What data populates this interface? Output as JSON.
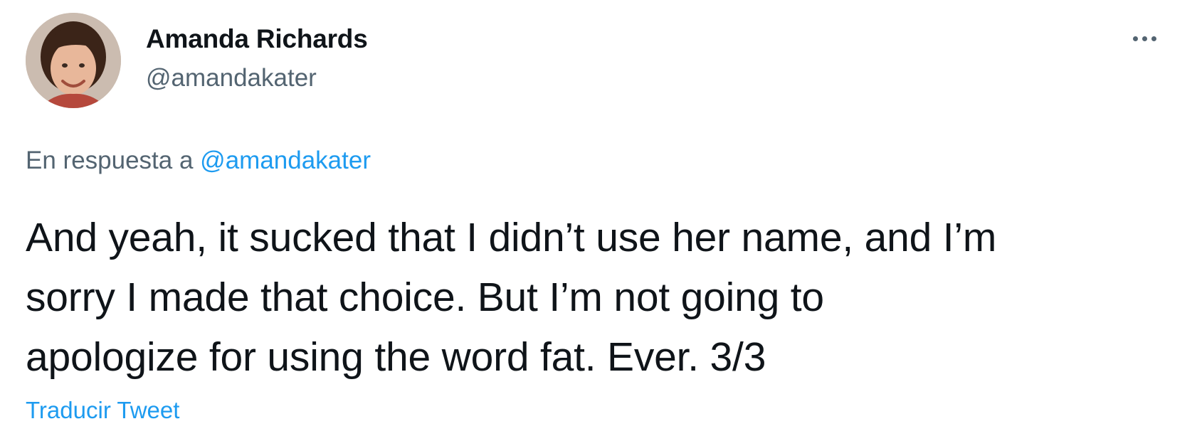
{
  "tweet": {
    "author": {
      "display_name": "Amanda Richards",
      "handle": "@amandakater",
      "avatar_icon": "avatar-photo"
    },
    "more_icon": "more-options-icon",
    "reply": {
      "prefix": "En respuesta a",
      "mention": "@amandakater"
    },
    "text_lines": [
      "And yeah, it sucked that I didn’t use her name, and I’m",
      "sorry I made that choice. But I’m not going to",
      "apologize for using the word fat. Ever. 3/3"
    ],
    "translate_label": "Traducir Tweet"
  },
  "colors": {
    "text_primary": "#0f1419",
    "text_secondary": "#536471",
    "link": "#1d9bf0"
  }
}
